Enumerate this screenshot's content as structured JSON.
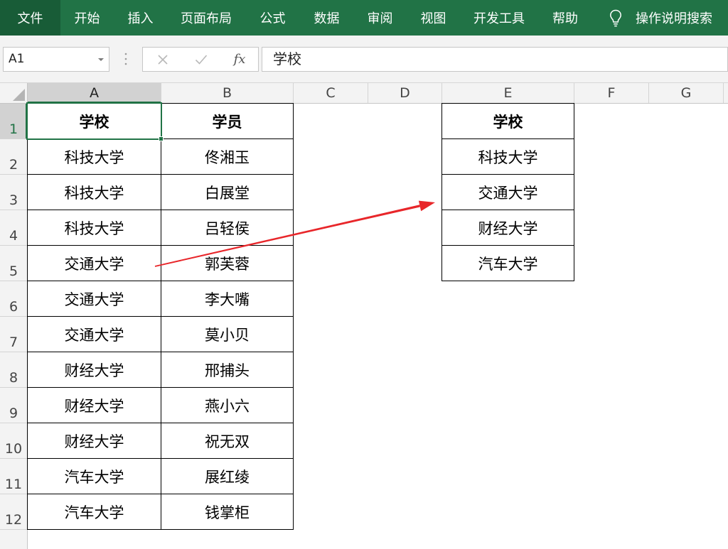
{
  "theme": {
    "ribbon_bg": "#217346",
    "file_tab_bg": "#185c37",
    "selection_color": "#217346",
    "arrow_color": "#e8262a"
  },
  "ribbon": {
    "file_tab": "文件",
    "tabs": [
      "开始",
      "插入",
      "页面布局",
      "公式",
      "数据",
      "审阅",
      "视图",
      "开发工具",
      "帮助"
    ],
    "tell_me": {
      "icon": "lightbulb-icon",
      "label": "操作说明搜索"
    }
  },
  "formula_bar": {
    "name_box": "A1",
    "name_box_icon": "chevron-down-icon",
    "cancel_icon": "cancel-icon",
    "enter_icon": "check-icon",
    "function_label": "fx",
    "content": "学校"
  },
  "sheet": {
    "columns": [
      "A",
      "B",
      "C",
      "D",
      "E",
      "F",
      "G"
    ],
    "row_numbers": [
      "1",
      "2",
      "3",
      "4",
      "5",
      "6",
      "7",
      "8",
      "9",
      "10",
      "11",
      "12"
    ],
    "main_table": {
      "header": [
        "学校",
        "学员"
      ],
      "rows": [
        [
          "科技大学",
          "佟湘玉"
        ],
        [
          "科技大学",
          "白展堂"
        ],
        [
          "科技大学",
          "吕轻侯"
        ],
        [
          "交通大学",
          "郭芙蓉"
        ],
        [
          "交通大学",
          "李大嘴"
        ],
        [
          "交通大学",
          "莫小贝"
        ],
        [
          "财经大学",
          "邢捕头"
        ],
        [
          "财经大学",
          "燕小六"
        ],
        [
          "财经大学",
          "祝无双"
        ],
        [
          "汽车大学",
          "展红绫"
        ],
        [
          "汽车大学",
          "钱掌柜"
        ]
      ]
    },
    "unique_table": {
      "header": "学校",
      "values": [
        "科技大学",
        "交通大学",
        "财经大学",
        "汽车大学"
      ]
    }
  }
}
